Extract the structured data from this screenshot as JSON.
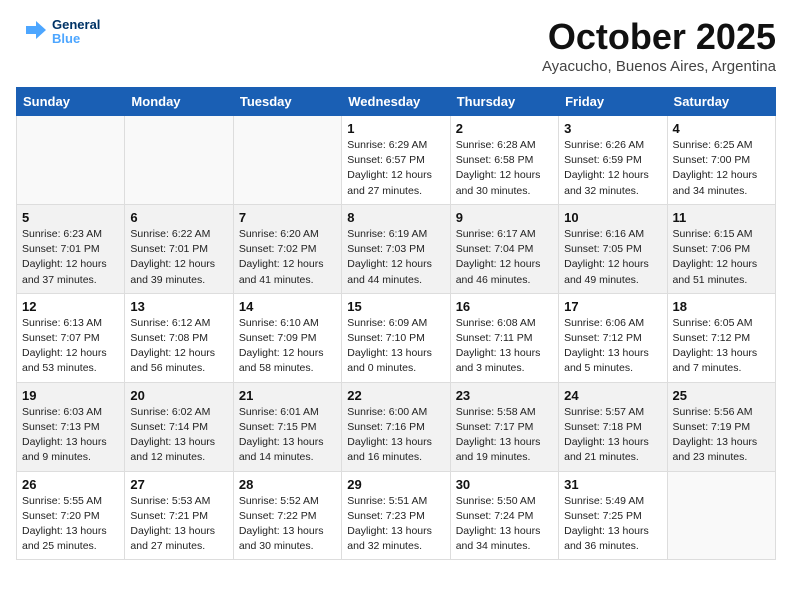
{
  "logo": {
    "text1": "General",
    "text2": "Blue"
  },
  "title": "October 2025",
  "subtitle": "Ayacucho, Buenos Aires, Argentina",
  "weekdays": [
    "Sunday",
    "Monday",
    "Tuesday",
    "Wednesday",
    "Thursday",
    "Friday",
    "Saturday"
  ],
  "weeks": [
    [
      {
        "day": "",
        "sunrise": "",
        "sunset": "",
        "daylight": ""
      },
      {
        "day": "",
        "sunrise": "",
        "sunset": "",
        "daylight": ""
      },
      {
        "day": "",
        "sunrise": "",
        "sunset": "",
        "daylight": ""
      },
      {
        "day": "1",
        "sunrise": "Sunrise: 6:29 AM",
        "sunset": "Sunset: 6:57 PM",
        "daylight": "Daylight: 12 hours and 27 minutes."
      },
      {
        "day": "2",
        "sunrise": "Sunrise: 6:28 AM",
        "sunset": "Sunset: 6:58 PM",
        "daylight": "Daylight: 12 hours and 30 minutes."
      },
      {
        "day": "3",
        "sunrise": "Sunrise: 6:26 AM",
        "sunset": "Sunset: 6:59 PM",
        "daylight": "Daylight: 12 hours and 32 minutes."
      },
      {
        "day": "4",
        "sunrise": "Sunrise: 6:25 AM",
        "sunset": "Sunset: 7:00 PM",
        "daylight": "Daylight: 12 hours and 34 minutes."
      }
    ],
    [
      {
        "day": "5",
        "sunrise": "Sunrise: 6:23 AM",
        "sunset": "Sunset: 7:01 PM",
        "daylight": "Daylight: 12 hours and 37 minutes."
      },
      {
        "day": "6",
        "sunrise": "Sunrise: 6:22 AM",
        "sunset": "Sunset: 7:01 PM",
        "daylight": "Daylight: 12 hours and 39 minutes."
      },
      {
        "day": "7",
        "sunrise": "Sunrise: 6:20 AM",
        "sunset": "Sunset: 7:02 PM",
        "daylight": "Daylight: 12 hours and 41 minutes."
      },
      {
        "day": "8",
        "sunrise": "Sunrise: 6:19 AM",
        "sunset": "Sunset: 7:03 PM",
        "daylight": "Daylight: 12 hours and 44 minutes."
      },
      {
        "day": "9",
        "sunrise": "Sunrise: 6:17 AM",
        "sunset": "Sunset: 7:04 PM",
        "daylight": "Daylight: 12 hours and 46 minutes."
      },
      {
        "day": "10",
        "sunrise": "Sunrise: 6:16 AM",
        "sunset": "Sunset: 7:05 PM",
        "daylight": "Daylight: 12 hours and 49 minutes."
      },
      {
        "day": "11",
        "sunrise": "Sunrise: 6:15 AM",
        "sunset": "Sunset: 7:06 PM",
        "daylight": "Daylight: 12 hours and 51 minutes."
      }
    ],
    [
      {
        "day": "12",
        "sunrise": "Sunrise: 6:13 AM",
        "sunset": "Sunset: 7:07 PM",
        "daylight": "Daylight: 12 hours and 53 minutes."
      },
      {
        "day": "13",
        "sunrise": "Sunrise: 6:12 AM",
        "sunset": "Sunset: 7:08 PM",
        "daylight": "Daylight: 12 hours and 56 minutes."
      },
      {
        "day": "14",
        "sunrise": "Sunrise: 6:10 AM",
        "sunset": "Sunset: 7:09 PM",
        "daylight": "Daylight: 12 hours and 58 minutes."
      },
      {
        "day": "15",
        "sunrise": "Sunrise: 6:09 AM",
        "sunset": "Sunset: 7:10 PM",
        "daylight": "Daylight: 13 hours and 0 minutes."
      },
      {
        "day": "16",
        "sunrise": "Sunrise: 6:08 AM",
        "sunset": "Sunset: 7:11 PM",
        "daylight": "Daylight: 13 hours and 3 minutes."
      },
      {
        "day": "17",
        "sunrise": "Sunrise: 6:06 AM",
        "sunset": "Sunset: 7:12 PM",
        "daylight": "Daylight: 13 hours and 5 minutes."
      },
      {
        "day": "18",
        "sunrise": "Sunrise: 6:05 AM",
        "sunset": "Sunset: 7:12 PM",
        "daylight": "Daylight: 13 hours and 7 minutes."
      }
    ],
    [
      {
        "day": "19",
        "sunrise": "Sunrise: 6:03 AM",
        "sunset": "Sunset: 7:13 PM",
        "daylight": "Daylight: 13 hours and 9 minutes."
      },
      {
        "day": "20",
        "sunrise": "Sunrise: 6:02 AM",
        "sunset": "Sunset: 7:14 PM",
        "daylight": "Daylight: 13 hours and 12 minutes."
      },
      {
        "day": "21",
        "sunrise": "Sunrise: 6:01 AM",
        "sunset": "Sunset: 7:15 PM",
        "daylight": "Daylight: 13 hours and 14 minutes."
      },
      {
        "day": "22",
        "sunrise": "Sunrise: 6:00 AM",
        "sunset": "Sunset: 7:16 PM",
        "daylight": "Daylight: 13 hours and 16 minutes."
      },
      {
        "day": "23",
        "sunrise": "Sunrise: 5:58 AM",
        "sunset": "Sunset: 7:17 PM",
        "daylight": "Daylight: 13 hours and 19 minutes."
      },
      {
        "day": "24",
        "sunrise": "Sunrise: 5:57 AM",
        "sunset": "Sunset: 7:18 PM",
        "daylight": "Daylight: 13 hours and 21 minutes."
      },
      {
        "day": "25",
        "sunrise": "Sunrise: 5:56 AM",
        "sunset": "Sunset: 7:19 PM",
        "daylight": "Daylight: 13 hours and 23 minutes."
      }
    ],
    [
      {
        "day": "26",
        "sunrise": "Sunrise: 5:55 AM",
        "sunset": "Sunset: 7:20 PM",
        "daylight": "Daylight: 13 hours and 25 minutes."
      },
      {
        "day": "27",
        "sunrise": "Sunrise: 5:53 AM",
        "sunset": "Sunset: 7:21 PM",
        "daylight": "Daylight: 13 hours and 27 minutes."
      },
      {
        "day": "28",
        "sunrise": "Sunrise: 5:52 AM",
        "sunset": "Sunset: 7:22 PM",
        "daylight": "Daylight: 13 hours and 30 minutes."
      },
      {
        "day": "29",
        "sunrise": "Sunrise: 5:51 AM",
        "sunset": "Sunset: 7:23 PM",
        "daylight": "Daylight: 13 hours and 32 minutes."
      },
      {
        "day": "30",
        "sunrise": "Sunrise: 5:50 AM",
        "sunset": "Sunset: 7:24 PM",
        "daylight": "Daylight: 13 hours and 34 minutes."
      },
      {
        "day": "31",
        "sunrise": "Sunrise: 5:49 AM",
        "sunset": "Sunset: 7:25 PM",
        "daylight": "Daylight: 13 hours and 36 minutes."
      },
      {
        "day": "",
        "sunrise": "",
        "sunset": "",
        "daylight": ""
      }
    ]
  ]
}
